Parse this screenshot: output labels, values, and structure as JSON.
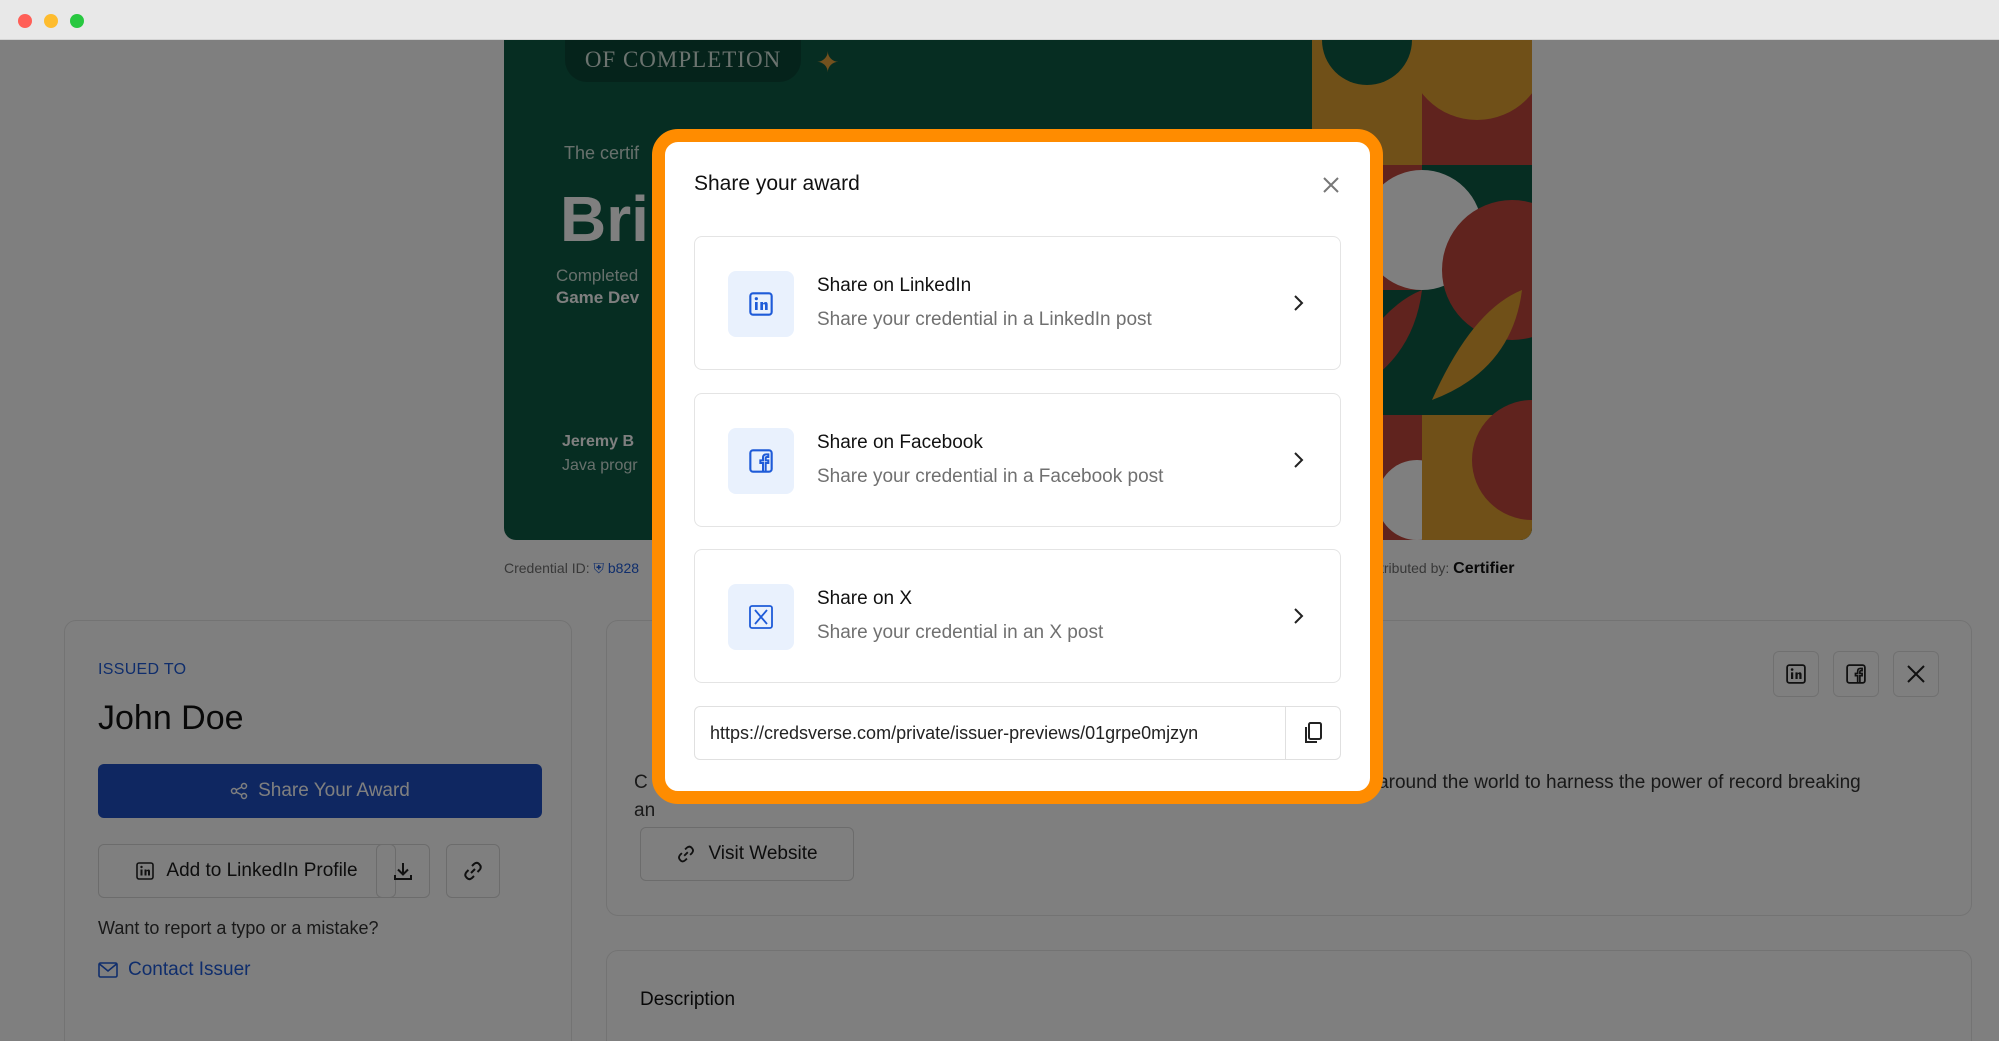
{
  "certificate": {
    "badge_text": "OF COMPLETION",
    "intro_text": "The certif",
    "recipient_partial": "Bri",
    "completed_text": "Completed",
    "course_partial": "Game Dev",
    "signer_partial": "Jeremy B",
    "signer_role_partial": "Java progr",
    "credential_label": "Credential ID:",
    "credential_value": "b828",
    "distributed_label": "tributed by:",
    "distributor": "Certifier"
  },
  "left_card": {
    "issued_to_label": "ISSUED TO",
    "recipient_name": "John Doe",
    "share_button": "Share Your Award",
    "add_linkedin_button": "Add to LinkedIn Profile",
    "report_text": "Want to report a typo or a mistake?",
    "contact_link": "Contact Issuer"
  },
  "right_card": {
    "about_text_left": "C",
    "about_text_right": "s around the world to harness the power of record breaking",
    "about_line2": "an",
    "visit_button": "Visit Website",
    "description_title": "Description"
  },
  "modal": {
    "title": "Share your award",
    "options": [
      {
        "title": "Share on LinkedIn",
        "subtitle": "Share your credential in a LinkedIn post",
        "icon": "linkedin-icon"
      },
      {
        "title": "Share on Facebook",
        "subtitle": "Share your credential in a Facebook post",
        "icon": "facebook-icon"
      },
      {
        "title": "Share on X",
        "subtitle": "Share your credential in an X post",
        "icon": "x-icon"
      }
    ],
    "url": "https://credsverse.com/private/issuer-previews/01grpe0mjzyn"
  },
  "colors": {
    "accent": "#1e4fc2",
    "highlight": "#ff8c00",
    "certificate_green": "#0d5a45"
  }
}
